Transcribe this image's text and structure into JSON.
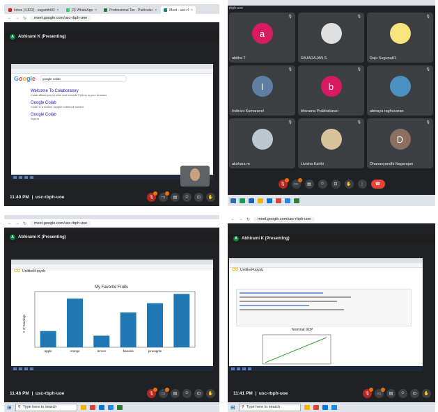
{
  "q1": {
    "tabs": [
      {
        "label": "Inbox (4,822) - sugantht03",
        "color": "#c5221f"
      },
      {
        "label": "(3) WhatsApp",
        "color": "#25d366"
      },
      {
        "label": "Professional Tax - Particular",
        "color": "#188038"
      },
      {
        "label": "Meet - usc-rl",
        "color": "#00897b"
      }
    ],
    "url": "meet.google.com/usc-rbph-uoe",
    "presenter": "Abhirami K (Presenting)",
    "presenter_initial": "A",
    "search_query": "google colab",
    "results": [
      {
        "title": "Welcome To Colaboratory",
        "text": "Colab allows you to write and execute Python in your browser"
      },
      {
        "title": "Google Colab",
        "text": "Colab is a hosted Jupyter notebook service"
      },
      {
        "title": "Google Colab",
        "text": "Sign in"
      }
    ],
    "time": "11:40 PM",
    "meeting_code": "usc-rbph-uoe"
  },
  "q2": {
    "url_tag": "rbph-uoe",
    "participants": [
      {
        "name": "abitha T",
        "initial": "a",
        "color": "#d81b60"
      },
      {
        "name": "RAJARAJAN S",
        "initial": "",
        "color": "#e0e0e0"
      },
      {
        "name": "Raju Suguna81",
        "initial": "",
        "color": "#f7e47c"
      },
      {
        "name": "Indirani Kumaravel",
        "initial": "I",
        "color": "#5f7ea3"
      },
      {
        "name": "bhuvana Prabhakaran",
        "initial": "b",
        "color": "#d81b60"
      },
      {
        "name": "abinaya raghuvaran",
        "initial": "",
        "color": "#4a90c2"
      },
      {
        "name": "akshara m",
        "initial": "",
        "color": "#bcc7cf"
      },
      {
        "name": "Livisha Karthi",
        "initial": "",
        "color": "#d8c39a"
      },
      {
        "name": "Dhanasyandhi Nagarajan",
        "initial": "D",
        "color": "#8d6e63"
      }
    ]
  },
  "q3": {
    "url": "meet.google.com/usc-rbph-uoe",
    "presenter": "Abhirami K (Presenting)",
    "notebook": "Untitled4.ipynb",
    "time": "11:46 PM",
    "meeting_code": "usc-rbph-uoe",
    "chart_data": {
      "type": "bar",
      "title": "My Favorite Fruits",
      "ylabel": "# of Servings",
      "categories": [
        "apple",
        "orange",
        "lemon",
        "banana",
        "pineapple"
      ],
      "values": [
        3.5,
        10.5,
        2.5,
        7.5,
        9.5
      ],
      "extra_values": [
        11.5
      ],
      "ylim": [
        0,
        12
      ],
      "color": "#1f77b4"
    }
  },
  "q4": {
    "url": "meet.google.com/usc-rbph-uoe",
    "presenter": "Abhirami K (Presenting)",
    "notebook": "Untitled4.ipynb",
    "chart_title": "Nominal GDP",
    "time": "11:41 PM",
    "meeting_code": "usc-rbph-uoe"
  },
  "taskbar": {
    "search_placeholder": "Type here to search"
  }
}
